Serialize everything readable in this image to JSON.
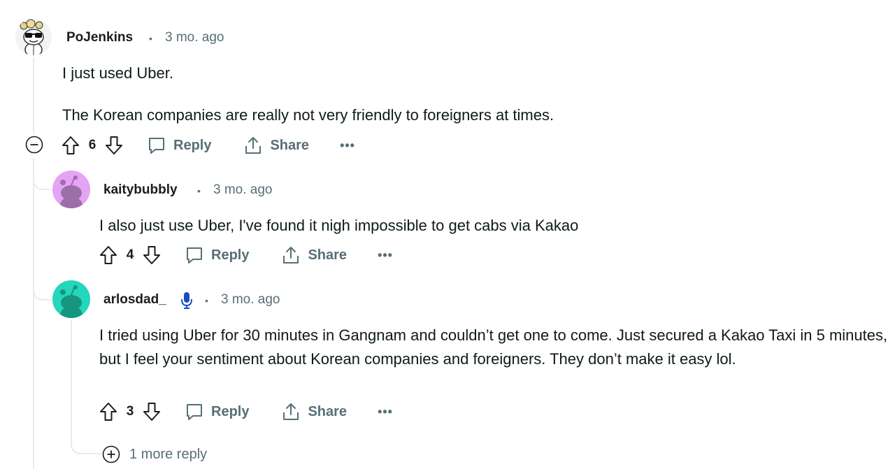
{
  "comments": [
    {
      "author": "PoJenkins",
      "separator": "•",
      "time": "3 mo. ago",
      "paragraphs": [
        "I just used Uber.",
        "The Korean companies are really not very friendly to foreigners at times."
      ],
      "votes": "6",
      "reply_label": "Reply",
      "share_label": "Share",
      "more_label": "•••",
      "avatar_icon": "sunglasses-snoo-icon"
    },
    {
      "author": "kaitybubbly",
      "separator": "•",
      "time": "3 mo. ago",
      "paragraphs": [
        "I also just use Uber, I've found it nigh impossible to get cabs via Kakao"
      ],
      "votes": "4",
      "reply_label": "Reply",
      "share_label": "Share",
      "more_label": "•••",
      "avatar_color": "#e5a3f5",
      "avatar_icon": "default-snoo-icon"
    },
    {
      "author": "arlosdad_",
      "separator": "•",
      "time": "3 mo. ago",
      "paragraphs": [
        "I tried using Uber for 30 minutes in Gangnam and couldn’t get one to come. Just secured a Kakao Taxi in 5 minutes, but I feel your sentiment about Korean companies and foreigners. They don’t make it easy lol."
      ],
      "votes": "3",
      "reply_label": "Reply",
      "share_label": "Share",
      "more_label": "•••",
      "avatar_color": "#24d6bc",
      "avatar_icon": "default-snoo-icon",
      "flair_icon": "microphone-icon"
    }
  ],
  "more_replies_label": "1 more reply",
  "colors": {
    "meta": "#576f76",
    "thread_line": "#e5ebee",
    "mic_blue": "#1a4dbf"
  }
}
